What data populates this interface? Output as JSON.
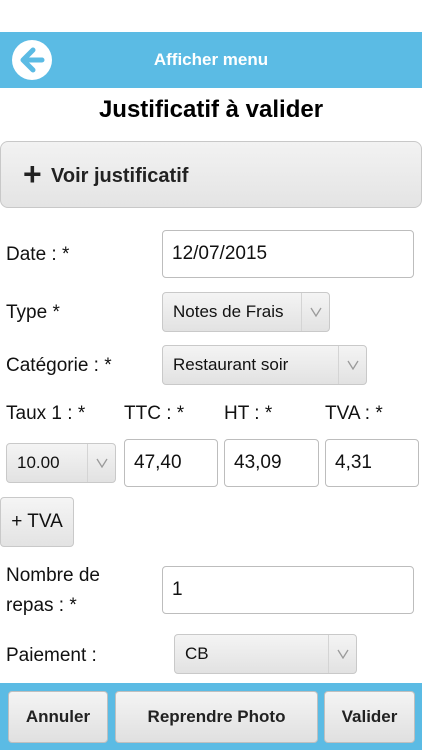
{
  "header": {
    "menu_label": "Afficher menu"
  },
  "page": {
    "title": "Justificatif à valider",
    "voir_plus": "+",
    "voir_label": "Voir justificatif"
  },
  "form": {
    "date": {
      "label": "Date : *",
      "value": "12/07/2015"
    },
    "type": {
      "label": "Type *",
      "selected": "Notes de Frais"
    },
    "categorie": {
      "label": "Catégorie : *",
      "selected": "Restaurant soir"
    },
    "taux": {
      "label": "Taux 1 : *",
      "selected": "10.00"
    },
    "ttc": {
      "label": "TTC : *",
      "value": "47,40"
    },
    "ht": {
      "label": "HT : *",
      "value": "43,09"
    },
    "tva": {
      "label": "TVA : *",
      "value": "4,31"
    },
    "add_tva_label": "+ TVA",
    "nombre_repas": {
      "label_line1": "Nombre de",
      "label_line2": "repas : *",
      "value": "1"
    },
    "paiement": {
      "label": "Paiement :",
      "selected": "CB"
    }
  },
  "footer": {
    "cancel_label": "Annuler",
    "retake_label": "Reprendre Photo",
    "validate_label": "Valider"
  },
  "colors": {
    "accent": "#5bbbe4"
  },
  "icons": {
    "back": "arrow-left-icon",
    "plus": "plus-icon",
    "select_arrow": "chevron-down-icon"
  }
}
